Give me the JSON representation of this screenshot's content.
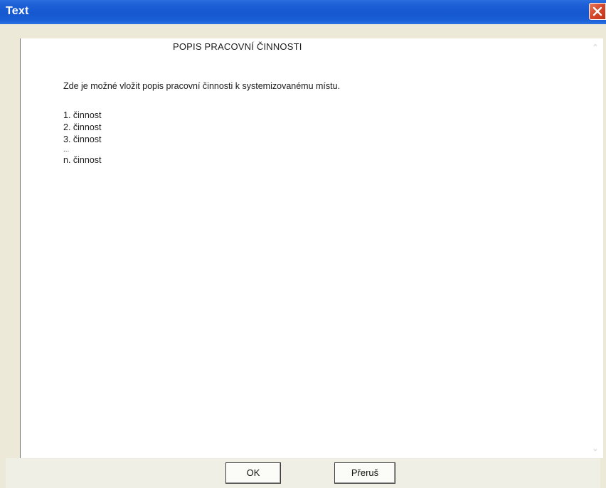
{
  "window": {
    "title": "Text",
    "close_icon": "close-icon"
  },
  "document": {
    "heading": "POPIS PRACOVNÍ ČINNOSTI",
    "intro": "Zde je možné vložit popis pracovní činnosti k systemizovanému místu.",
    "items": [
      "1. činnost",
      "2. činnost",
      "3. činnost",
      "...",
      "n. činnost"
    ]
  },
  "scrollbar": {
    "up_icon": "scroll-up-arrow-icon",
    "down_icon": "scroll-down-arrow-icon",
    "up_glyph": "⌃",
    "down_glyph": "⌄"
  },
  "buttons": {
    "ok_label": "OK",
    "cancel_label": "Přeruš"
  },
  "colors": {
    "titlebar": "#1558cf",
    "close_button": "#d6462a",
    "dialog_background": "#ece9d8",
    "text_area": "#ffffff"
  }
}
